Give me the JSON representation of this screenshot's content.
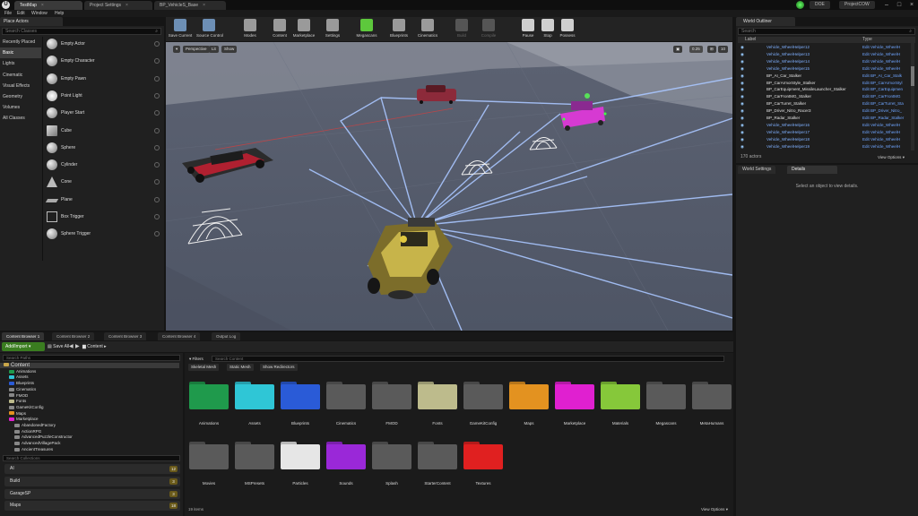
{
  "window": {
    "logo": "U",
    "tabs": [
      "TestMap",
      "Project Settings",
      "BP_VehicleS_Base"
    ],
    "close_glyph": "×",
    "right_buttons": [
      "DOE",
      "ProjectCOW"
    ],
    "controls": [
      "–",
      "□",
      "×"
    ]
  },
  "menu": [
    "File",
    "Edit",
    "Window",
    "Help"
  ],
  "place_actors": {
    "tab": "Place Actors",
    "search_placeholder": "Search Classes",
    "categories": [
      "Recently Placed",
      "Basic",
      "Lights",
      "Cinematic",
      "Visual Effects",
      "Geometry",
      "Volumes",
      "All Classes"
    ],
    "active_category": "Basic",
    "actors": [
      {
        "label": "Empty Actor",
        "icon": "sphere"
      },
      {
        "label": "Empty Character",
        "icon": "sphere"
      },
      {
        "label": "Empty Pawn",
        "icon": "sphere"
      },
      {
        "label": "Point Light",
        "icon": "light"
      },
      {
        "label": "Player Start",
        "icon": "sphere"
      },
      {
        "label": "Cube",
        "icon": "cube"
      },
      {
        "label": "Sphere",
        "icon": "sphere"
      },
      {
        "label": "Cylinder",
        "icon": "sphere"
      },
      {
        "label": "Cone",
        "icon": "cone"
      },
      {
        "label": "Plane",
        "icon": "plane"
      },
      {
        "label": "Box Trigger",
        "icon": "box"
      },
      {
        "label": "Sphere Trigger",
        "icon": "sphere"
      }
    ]
  },
  "toolbar": {
    "buttons": [
      {
        "label": "Save Current",
        "color": "#6d8fb5",
        "enabled": true
      },
      {
        "label": "Source Control",
        "color": "#6d8fb5",
        "enabled": true
      },
      {
        "label": "Modes",
        "color": "#9a9a9a",
        "enabled": true
      },
      {
        "label": "Content",
        "color": "#9a9a9a",
        "enabled": true
      },
      {
        "label": "Marketplace",
        "color": "#9a9a9a",
        "enabled": true
      },
      {
        "label": "Settings",
        "color": "#9a9a9a",
        "enabled": true
      },
      {
        "label": "Megascans",
        "color": "#5dc83c",
        "enabled": true
      },
      {
        "label": "Blueprints",
        "color": "#9a9a9a",
        "enabled": true
      },
      {
        "label": "Cinematics",
        "color": "#9a9a9a",
        "enabled": true
      },
      {
        "label": "Build",
        "color": "#555555",
        "enabled": false
      },
      {
        "label": "Compile",
        "color": "#555555",
        "enabled": false
      },
      {
        "label": "Pause",
        "color": "#cfcfcf",
        "enabled": true
      },
      {
        "label": "Stop",
        "color": "#cfcfcf",
        "enabled": true
      },
      {
        "label": "Possess",
        "color": "#cfcfcf",
        "enabled": true
      }
    ]
  },
  "viewport": {
    "buttons": [
      "Perspective",
      "Lit",
      "Show"
    ],
    "zoom": "0.25",
    "grid": "10"
  },
  "outliner": {
    "tab": "World Outliner",
    "search_placeholder": "Search",
    "col_label": "Label",
    "col_type": "Type",
    "rows": [
      {
        "label": "Vehicle_WheelHelper12",
        "type": "Edit Vehicle_WheelH",
        "bp": false
      },
      {
        "label": "Vehicle_WheelHelper13",
        "type": "Edit Vehicle_WheelH",
        "bp": false
      },
      {
        "label": "Vehicle_WheelHelper14",
        "type": "Edit Vehicle_WheelH",
        "bp": false
      },
      {
        "label": "Vehicle_WheelHelper15",
        "type": "Edit Vehicle_WheelH",
        "bp": false
      },
      {
        "label": "BP_AI_Car_Stalker",
        "type": "Edit BP_AI_Car_Stalk",
        "bp": true
      },
      {
        "label": "BP_CarArmorStyle_Stalker",
        "type": "Edit BP_CarArmorStyl",
        "bp": true
      },
      {
        "label": "BP_CarEquipment_MissileLauncher_Stalker",
        "type": "Edit BP_CarEquipmen",
        "bp": true
      },
      {
        "label": "BP_CarFrontMG_Stalker",
        "type": "Edit BP_CarFrontMG",
        "bp": true
      },
      {
        "label": "BP_CarTurret_Stalker",
        "type": "Edit BP_CarTurret_Sta",
        "bp": true
      },
      {
        "label": "BP_Driver_Nitro_Racer3",
        "type": "Edit BP_Driver_Nitro_",
        "bp": true
      },
      {
        "label": "BP_Radar_Stalker",
        "type": "Edit BP_Radar_Stalker",
        "bp": true
      },
      {
        "label": "Vehicle_WheelHelper16",
        "type": "Edit Vehicle_WheelH",
        "bp": false
      },
      {
        "label": "Vehicle_WheelHelper17",
        "type": "Edit Vehicle_WheelH",
        "bp": false
      },
      {
        "label": "Vehicle_WheelHelper18",
        "type": "Edit Vehicle_WheelH",
        "bp": false
      },
      {
        "label": "Vehicle_WheelHelper19",
        "type": "Edit Vehicle_WheelH",
        "bp": false
      }
    ],
    "actor_count": "170 actors",
    "view_options": "View Options"
  },
  "details": {
    "tabs": [
      "World Settings",
      "Details"
    ],
    "empty_message": "Select an object to view details."
  },
  "bottom_tabs": [
    "Content Browser 1",
    "Content Browser 2",
    "Content Browser 3",
    "Content Browser 4",
    "Output Log"
  ],
  "content_browser": {
    "add_import": "Add/Import",
    "save_all": "Save All",
    "breadcrumb": "Content",
    "search_paths_placeholder": "Search Paths",
    "tree": [
      {
        "label": "Content",
        "color": "#c9a64a",
        "indent": 0,
        "selected": true
      },
      {
        "label": "Animations",
        "color": "#1f9a4c",
        "indent": 1,
        "selected": false
      },
      {
        "label": "Assets",
        "color": "#2fc6d6",
        "indent": 1,
        "selected": false
      },
      {
        "label": "Blueprints",
        "color": "#2a5bd7",
        "indent": 1,
        "selected": false
      },
      {
        "label": "Cinematics",
        "color": "#888888",
        "indent": 1,
        "selected": false
      },
      {
        "label": "FMOD",
        "color": "#888888",
        "indent": 1,
        "selected": false
      },
      {
        "label": "Fonts",
        "color": "#bdbb8c",
        "indent": 1,
        "selected": false
      },
      {
        "label": "GameKitConfig",
        "color": "#888888",
        "indent": 1,
        "selected": false
      },
      {
        "label": "Maps",
        "color": "#e39220",
        "indent": 1,
        "selected": false
      },
      {
        "label": "Marketplace",
        "color": "#e020d0",
        "indent": 1,
        "selected": false
      },
      {
        "label": "AbandonedFactory",
        "color": "#888888",
        "indent": 2,
        "selected": false
      },
      {
        "label": "ActionRPG",
        "color": "#888888",
        "indent": 2,
        "selected": false
      },
      {
        "label": "AdvancedPuzzleConstructor",
        "color": "#888888",
        "indent": 2,
        "selected": false
      },
      {
        "label": "AdvancedVillagePack",
        "color": "#888888",
        "indent": 2,
        "selected": false
      },
      {
        "label": "AncientTreasures",
        "color": "#888888",
        "indent": 2,
        "selected": false
      }
    ],
    "search_collections_placeholder": "Search Collections",
    "collections": [
      {
        "label": "AI",
        "count": "12"
      },
      {
        "label": "Build",
        "count": "3"
      },
      {
        "label": "GarageSP",
        "count": "3"
      },
      {
        "label": "Maps",
        "count": "18"
      }
    ],
    "filters_label": "Filters",
    "search_content_placeholder": "Search Content",
    "filter_chips": [
      "Skeletal Mesh",
      "Static Mesh",
      "Show Redirectors"
    ],
    "folders": [
      {
        "label": "Animations",
        "color": "#1f9a4c"
      },
      {
        "label": "Assets",
        "color": "#2fc6d6"
      },
      {
        "label": "Blueprints",
        "color": "#2a5bd7"
      },
      {
        "label": "Cinematics",
        "color": "#5a5a5a"
      },
      {
        "label": "FMOD",
        "color": "#5a5a5a"
      },
      {
        "label": "Fonts",
        "color": "#bdbb8c"
      },
      {
        "label": "GameKitConfig",
        "color": "#5a5a5a"
      },
      {
        "label": "Maps",
        "color": "#e39220"
      },
      {
        "label": "Marketplace",
        "color": "#e020d0"
      },
      {
        "label": "Materials",
        "color": "#86c83a"
      },
      {
        "label": "Megascans",
        "color": "#5a5a5a"
      },
      {
        "label": "MetaHumans",
        "color": "#5a5a5a"
      },
      {
        "label": "Movies",
        "color": "#5a5a5a"
      },
      {
        "label": "MSPresets",
        "color": "#5a5a5a"
      },
      {
        "label": "Particles",
        "color": "#e6e6e6"
      },
      {
        "label": "Sounds",
        "color": "#9a28d8"
      },
      {
        "label": "Splash",
        "color": "#5a5a5a"
      },
      {
        "label": "StarterContent",
        "color": "#5a5a5a"
      },
      {
        "label": "Textures",
        "color": "#e02020"
      }
    ],
    "item_count": "19 items",
    "view_options": "View Options"
  }
}
